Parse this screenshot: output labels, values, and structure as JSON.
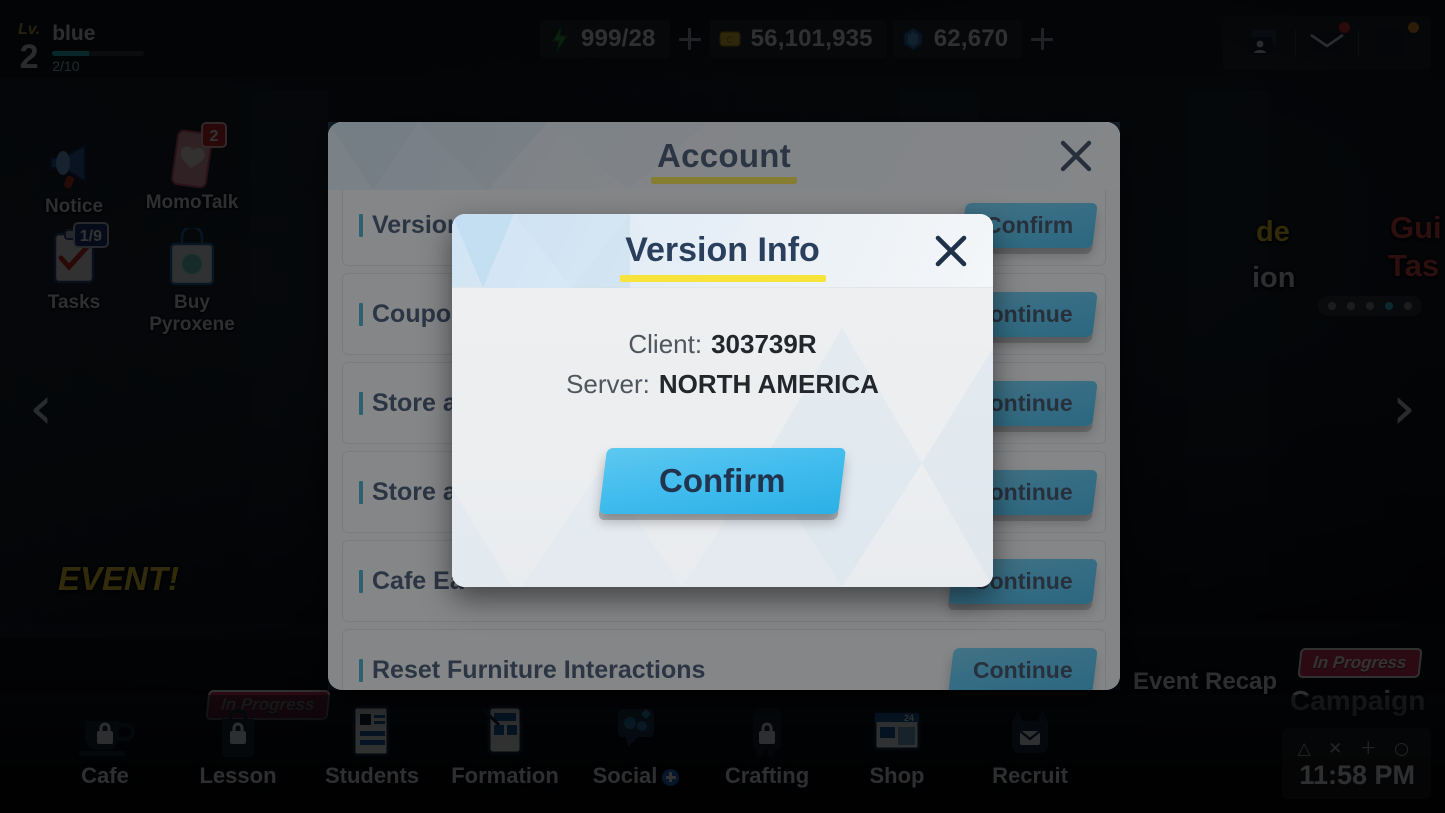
{
  "hud": {
    "player": {
      "lv_label": "Lv.",
      "level": "2",
      "name": "blue",
      "xp_text": "2/10"
    },
    "currencies": [
      {
        "icon": "ap-bolt-icon",
        "value": "999/28",
        "has_plus": true
      },
      {
        "icon": "credits-icon",
        "value": "56,101,935",
        "has_plus": false
      },
      {
        "icon": "pyroxene-icon",
        "value": "62,670",
        "has_plus": true
      }
    ],
    "top_right": [
      {
        "icon": "profile-card-icon",
        "badge": ""
      },
      {
        "icon": "mail-icon",
        "badge": "red"
      },
      {
        "icon": "menu-grid-icon",
        "badge": "orange"
      }
    ]
  },
  "shortcuts": [
    {
      "label": "Notice",
      "icon": "megaphone-icon",
      "badge": ""
    },
    {
      "label": "MomoTalk",
      "icon": "phone-icon",
      "badge": "2"
    },
    {
      "label": "Tasks",
      "icon": "clipboard-icon",
      "badge": "1/9"
    },
    {
      "label": "Buy Pyroxene",
      "icon": "shopping-bag-icon",
      "badge": ""
    }
  ],
  "background_labels": {
    "de": "de",
    "ion": "ion",
    "gui": "Gui",
    "tas": "Tas",
    "event_recap": "Event Recap",
    "campaign": "Campaign",
    "in_progress": "In Progress"
  },
  "carousel": {
    "left_arrow": "‹",
    "right_arrow": "›",
    "dots": 5,
    "active_dot": 3
  },
  "bottom_nav": [
    {
      "label": "Cafe",
      "icon": "coffee-cup-icon",
      "locked": true,
      "badge": ""
    },
    {
      "label": "Lesson",
      "icon": "backpack-icon",
      "locked": true,
      "badge": "In Progress"
    },
    {
      "label": "Students",
      "icon": "student-list-icon",
      "locked": false,
      "badge": ""
    },
    {
      "label": "Formation",
      "icon": "formation-tablet-icon",
      "locked": false,
      "badge": ""
    },
    {
      "label": "Social",
      "icon": "chat-bubble-icon",
      "locked": false,
      "badge": ""
    },
    {
      "label": "Crafting",
      "icon": "crafting-icon",
      "locked": true,
      "badge": ""
    },
    {
      "label": "Shop",
      "icon": "storefront-icon",
      "locked": false,
      "badge": ""
    },
    {
      "label": "Recruit",
      "icon": "recruit-icon",
      "locked": false,
      "badge": ""
    }
  ],
  "clock": {
    "glyphs": "△ ✕ ＋ ○",
    "time": "11:58 PM"
  },
  "account_dialog": {
    "title": "Account",
    "close_icon": "close-icon",
    "rows": [
      {
        "label": "Version Info",
        "action": "Confirm"
      },
      {
        "label": "Coupon",
        "action": "Continue"
      },
      {
        "label": "Store a",
        "action": "Continue"
      },
      {
        "label": "Store a",
        "action": "Continue"
      },
      {
        "label": "Cafe Ea",
        "action": "Continue"
      },
      {
        "label": "Reset Furniture Interactions",
        "action": "Continue"
      }
    ]
  },
  "version_modal": {
    "title": "Version Info",
    "close_icon": "close-icon",
    "fields": [
      {
        "key": "Client:",
        "value": "303739R"
      },
      {
        "key": "Server:",
        "value": "NORTH AMERICA"
      }
    ],
    "confirm_label": "Confirm"
  },
  "colors": {
    "accent_yellow": "#f5e236",
    "accent_blue": "#43bdee",
    "title_navy": "#2a3f5c",
    "row_bar": "#2f9fc4",
    "badge_red": "#cf2b32",
    "in_progress": "#d5325f"
  }
}
